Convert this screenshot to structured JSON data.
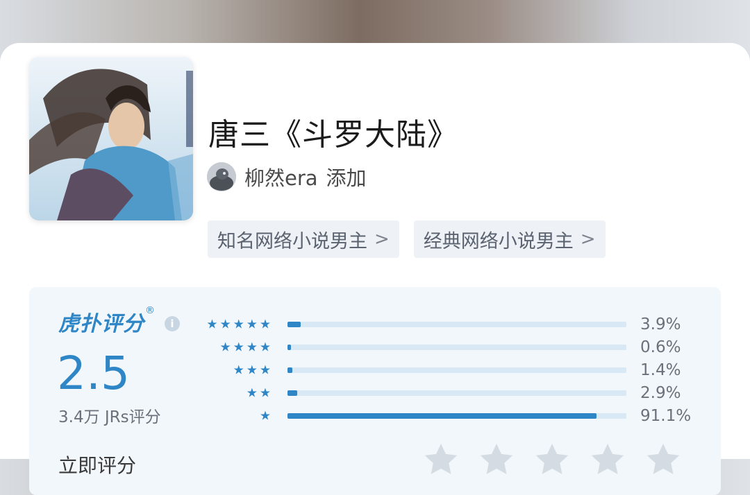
{
  "title": "唐三《斗罗大陆》",
  "author": {
    "name": "柳然era",
    "action": "添加"
  },
  "tags": [
    {
      "label": "知名网络小说男主",
      "icon": "chevron-right-icon"
    },
    {
      "label": "经典网络小说男主",
      "icon": "chevron-right-icon"
    }
  ],
  "rating": {
    "brand": "虎扑评分",
    "brand_mark": "®",
    "info_icon": "i",
    "score": "2.5",
    "count": "3.4万 JRs评分",
    "accent_color": "#2f86c6",
    "distribution": [
      {
        "stars": 5,
        "stars_text": "★★★★★",
        "percent": 3.9,
        "label": "3.9%"
      },
      {
        "stars": 4,
        "stars_text": "★★★★",
        "percent": 0.6,
        "label": "0.6%"
      },
      {
        "stars": 3,
        "stars_text": "★★★",
        "percent": 1.4,
        "label": "1.4%"
      },
      {
        "stars": 2,
        "stars_text": "★★",
        "percent": 2.9,
        "label": "2.9%"
      },
      {
        "stars": 1,
        "stars_text": "★",
        "percent": 91.1,
        "label": "91.1%"
      }
    ],
    "rate_now_label": "立即评分",
    "rate_star_count": 5,
    "rate_star_color": "#d5dbe2"
  }
}
